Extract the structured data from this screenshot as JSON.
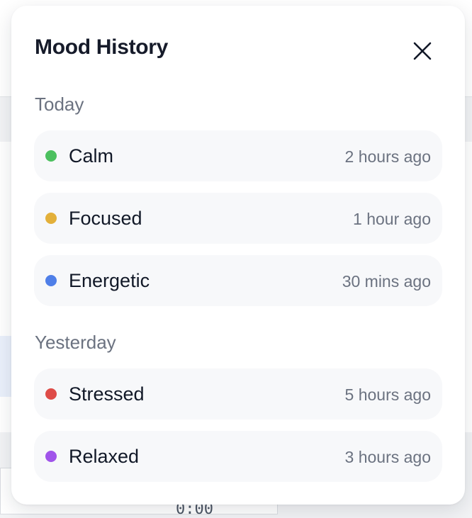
{
  "background": {
    "clock_text": "0:00"
  },
  "modal": {
    "title": "Mood History",
    "close_icon": "close-icon"
  },
  "sections": [
    {
      "heading": "Today",
      "entries": [
        {
          "mood": "Calm",
          "time": "2 hours ago",
          "color": "#4cc05f"
        },
        {
          "mood": "Focused",
          "time": "1 hour ago",
          "color": "#e3b03a"
        },
        {
          "mood": "Energetic",
          "time": "30 mins ago",
          "color": "#4f7fe8"
        }
      ]
    },
    {
      "heading": "Yesterday",
      "entries": [
        {
          "mood": "Stressed",
          "time": "5 hours ago",
          "color": "#de4c48"
        },
        {
          "mood": "Relaxed",
          "time": "3 hours ago",
          "color": "#a054ea"
        }
      ]
    }
  ]
}
